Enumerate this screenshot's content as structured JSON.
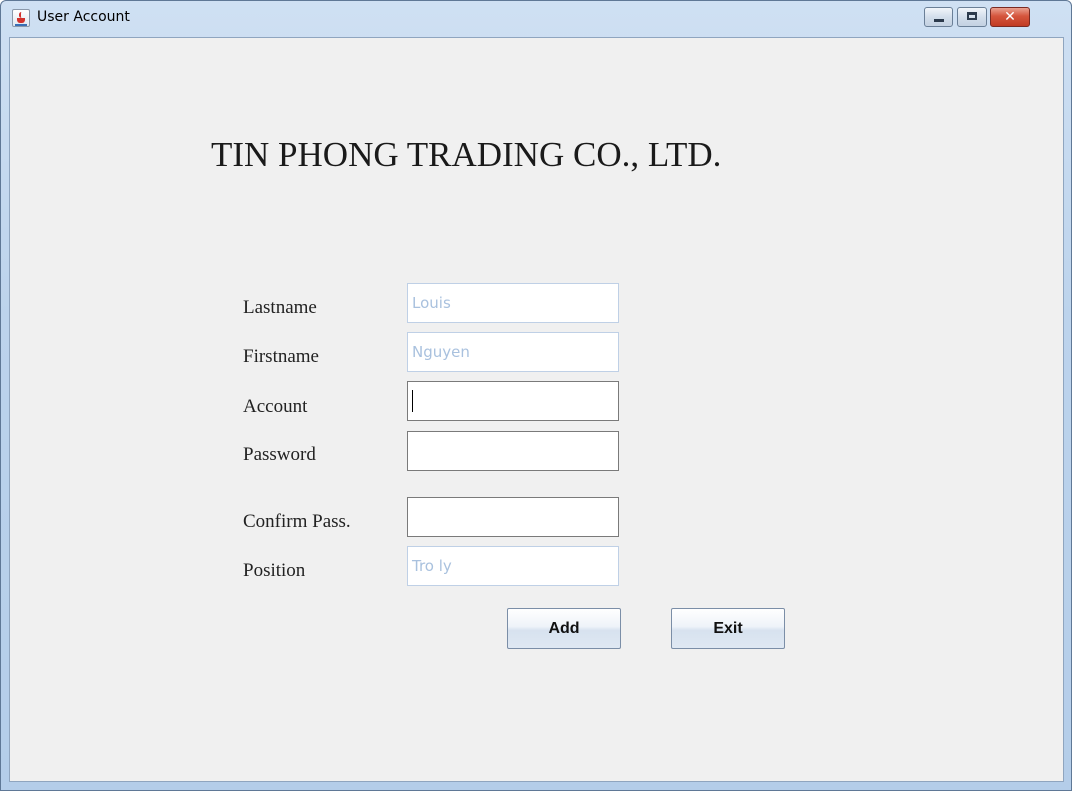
{
  "window": {
    "title": "User Account",
    "icon": "java-cup-icon",
    "controls": [
      "minimize-icon",
      "maximize-icon",
      "close-icon"
    ],
    "close_glyph": "✕"
  },
  "form": {
    "company_name": "TIN PHONG TRADING CO., LTD.",
    "fields": [
      {
        "label": "Lastname",
        "value": "Louis",
        "enabled": false
      },
      {
        "label": "Firstname",
        "value": "Nguyen",
        "enabled": false
      },
      {
        "label": "Account",
        "value": "",
        "enabled": true,
        "focused": true
      },
      {
        "label": "Password",
        "value": "",
        "enabled": true
      },
      {
        "label": "Confirm Pass.",
        "value": "",
        "enabled": true
      },
      {
        "label": "Position",
        "value": "Tro ly",
        "enabled": false
      }
    ],
    "buttons": {
      "add": "Add",
      "exit": "Exit"
    }
  },
  "colors": {
    "disabled_text": "#a9c1de",
    "close_button": "#c13b22"
  }
}
